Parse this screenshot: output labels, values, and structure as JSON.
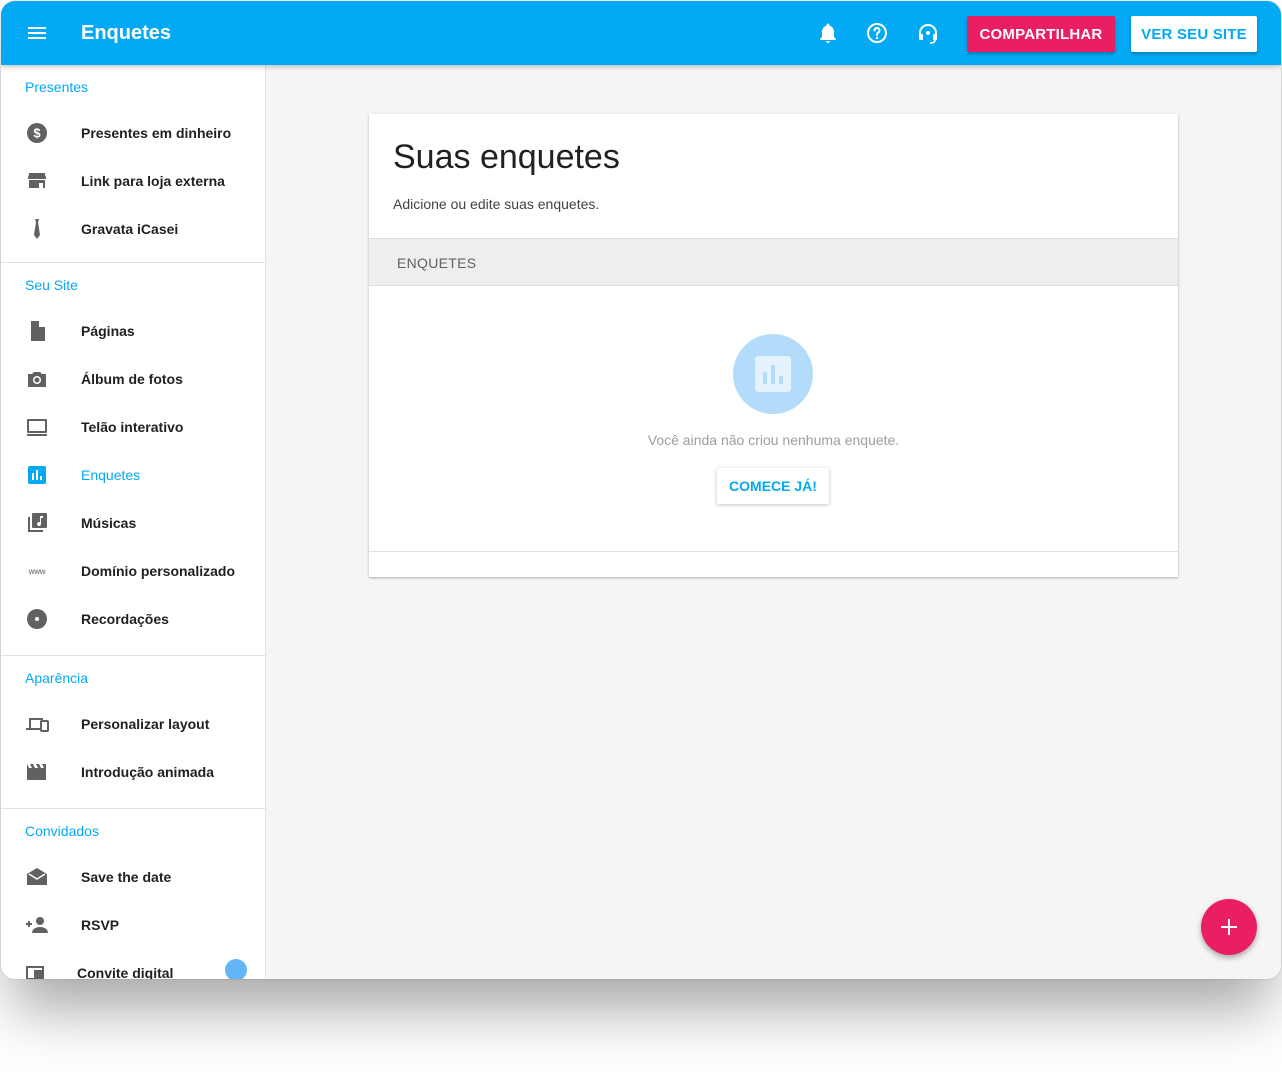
{
  "colors": {
    "primary": "#03a9f4",
    "accent": "#e91e63",
    "empty_icon_bg": "#b3dcfa"
  },
  "header": {
    "title": "Enquetes",
    "icons": [
      "menu-icon",
      "bell-icon",
      "help-icon",
      "headset-icon"
    ],
    "share_label": "COMPARTILHAR",
    "site_label": "VER SEU SITE"
  },
  "sidebar": {
    "sections": [
      {
        "title": "Presentes",
        "items": [
          {
            "label": "Presentes em dinheiro",
            "icon": "dollar-icon"
          },
          {
            "label": "Link para loja externa",
            "icon": "store-icon"
          },
          {
            "label": "Gravata iCasei",
            "icon": "tie-icon"
          }
        ]
      },
      {
        "title": "Seu Site",
        "items": [
          {
            "label": "Páginas",
            "icon": "page-icon"
          },
          {
            "label": "Álbum de fotos",
            "icon": "camera-icon"
          },
          {
            "label": "Telão interativo",
            "icon": "monitor-icon"
          },
          {
            "label": "Enquetes",
            "icon": "poll-icon",
            "active": true
          },
          {
            "label": "Músicas",
            "icon": "music-library-icon"
          },
          {
            "label": "Domínio personalizado",
            "icon": "www-icon"
          },
          {
            "label": "Recordações",
            "icon": "disc-icon"
          }
        ]
      },
      {
        "title": "Aparência",
        "items": [
          {
            "label": "Personalizar layout",
            "icon": "devices-icon"
          },
          {
            "label": "Introdução animada",
            "icon": "clapperboard-icon"
          }
        ]
      },
      {
        "title": "Convidados",
        "items": [
          {
            "label": "Save the date",
            "icon": "envelope-open-icon"
          },
          {
            "label": "RSVP",
            "icon": "add-person-icon"
          },
          {
            "label": "Convite digital",
            "icon": "invite-icon"
          }
        ]
      }
    ]
  },
  "main": {
    "title": "Suas enquetes",
    "subtitle": "Adicione ou edite suas enquetes.",
    "table_header": "ENQUETES",
    "empty_message": "Você ainda não criou nenhuma enquete.",
    "start_label": "COMECE JÁ!"
  },
  "fab": {
    "icon": "plus-icon"
  }
}
